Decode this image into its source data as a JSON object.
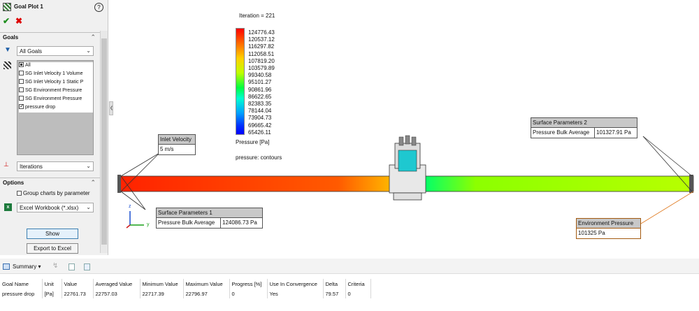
{
  "panel": {
    "title": "Goal Plot 1",
    "goals_section": "Goals",
    "goals_filter": "All Goals",
    "goal_items": [
      {
        "label": "All",
        "state": "partial"
      },
      {
        "label": "SG Inlet Velocity 1 Volume",
        "state": "unchecked"
      },
      {
        "label": "SG Inlet Velocity 1 Static P",
        "state": "unchecked"
      },
      {
        "label": "SG Environment Pressure",
        "state": "unchecked"
      },
      {
        "label": "SG Environment Pressure",
        "state": "unchecked"
      },
      {
        "label": "pressure drop",
        "state": "checked"
      }
    ],
    "x_axis_select": "Iterations",
    "options_section": "Options",
    "group_charts_label": "Group charts by parameter",
    "export_format": "Excel Workbook (*.xlsx)",
    "show_button": "Show",
    "export_button": "Export to Excel"
  },
  "viewport": {
    "iteration_label": "Iteration = 221",
    "legend_values": [
      "124776.43",
      "120537.12",
      "116297.82",
      "112058.51",
      "107819.20",
      "103579.89",
      "99340.58",
      "95101.27",
      "90861.96",
      "86622.65",
      "82383.35",
      "78144.04",
      "73904.73",
      "69665.42",
      "65426.11"
    ],
    "legend_unit": "Pressure [Pa]",
    "plot_name": "pressure: contours",
    "inlet_velocity": {
      "title": "Inlet Velocity",
      "value": "5 m/s"
    },
    "surface_params_2": {
      "title": "Surface Parameters 2",
      "label": "Pressure Bulk Average",
      "value": "101327.91 Pa"
    },
    "surface_params_1": {
      "title": "Surface Parameters 1",
      "label": "Pressure Bulk Average",
      "value": "124086.73 Pa"
    },
    "environment_pressure": {
      "title": "Environment Pressure",
      "value": "101325 Pa"
    },
    "axis_labels": {
      "z": "z",
      "y": "y",
      "x": "x"
    },
    "colors": {
      "high": "#ff0000",
      "mid": "#00ff00",
      "low": "#0000ff",
      "accent_callout": "#cc6600"
    }
  },
  "bottom": {
    "summary_label": "Summary",
    "columns": [
      "Goal Name",
      "Unit",
      "Value",
      "Averaged Value",
      "Minimum Value",
      "Maximum Value",
      "Progress [%]",
      "Use In Convergence",
      "Delta",
      "Criteria"
    ],
    "rows": [
      [
        "pressure drop",
        "[Pa]",
        "22761.73",
        "22757.03",
        "22717.39",
        "22796.97",
        "0",
        "Yes",
        "79.57",
        "0"
      ]
    ]
  }
}
